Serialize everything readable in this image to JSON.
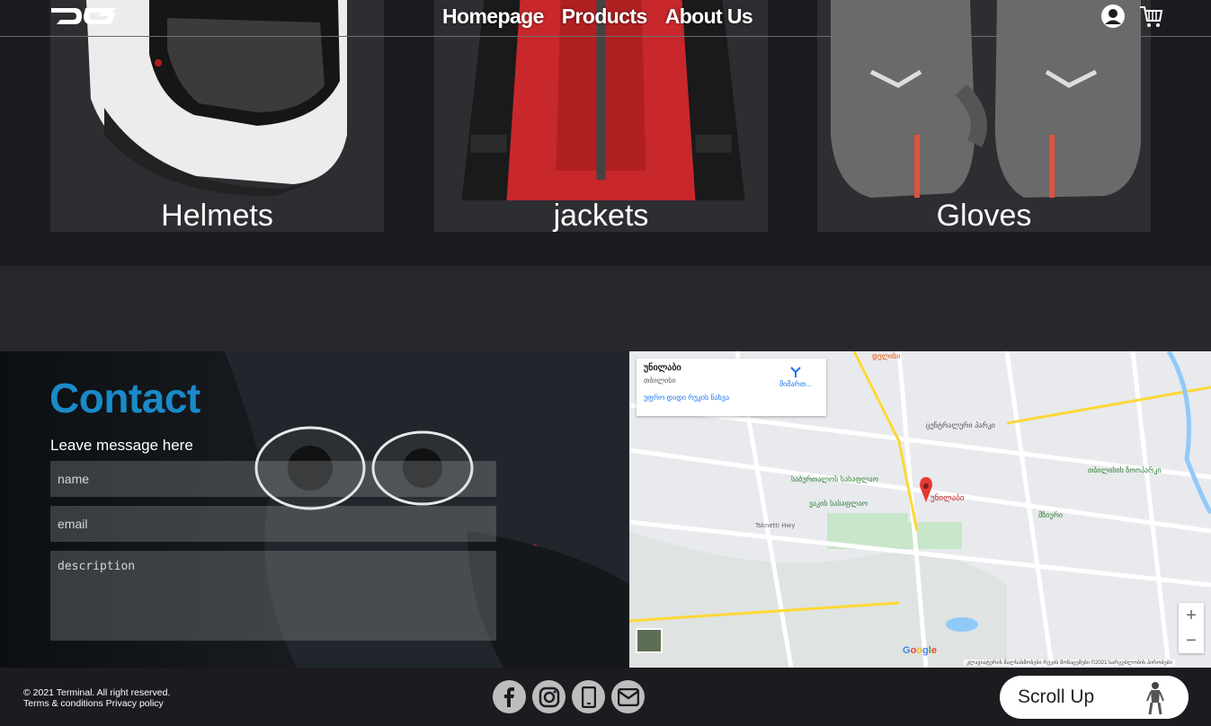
{
  "nav": {
    "items": [
      "Homepage",
      "Products",
      "About Us"
    ]
  },
  "header_icons": [
    "user-icon",
    "cart-icon"
  ],
  "products": [
    {
      "label": "Helmets"
    },
    {
      "label": "jackets"
    },
    {
      "label": "Gloves"
    }
  ],
  "contact": {
    "title": "Contact",
    "subtitle": "Leave message here",
    "name_placeholder": "name",
    "email_placeholder": "email",
    "description_placeholder": "description"
  },
  "map": {
    "place_name": "უნილაბი",
    "place_city": "თბილისი",
    "directions_label": "მიმართ...",
    "larger_map_link": "უფრო დიდი რუკის ნახვა",
    "labels": [
      "ცენტრალური პარკი",
      "საბურთალოს სასაფლაო",
      "ვაკის სასაფლაო",
      "ვაკის სასაფლაო",
      "თბილისის ზოოპარკი",
      "მზიური",
      "დელისი",
      "Tsknetti Hwy",
      "უნილაბი"
    ],
    "google_logo": "Google",
    "footer_text": "კლავიატურის მალსახმობები   რუკის მონაცემები ©2021   სარგებლობის პირობები",
    "zoom_in": "+",
    "zoom_out": "−"
  },
  "footer": {
    "copyright": "© 2021 Terminal. All right reserved.",
    "links": "Terms & conditions Privacy policy",
    "social": [
      "facebook-icon",
      "instagram-icon",
      "phone-icon",
      "mail-icon"
    ],
    "scroll_label": "Scroll Up"
  },
  "colors": {
    "accent": "#1a8ac8",
    "bg": "#1c1b20",
    "card": "#2e2d32"
  }
}
